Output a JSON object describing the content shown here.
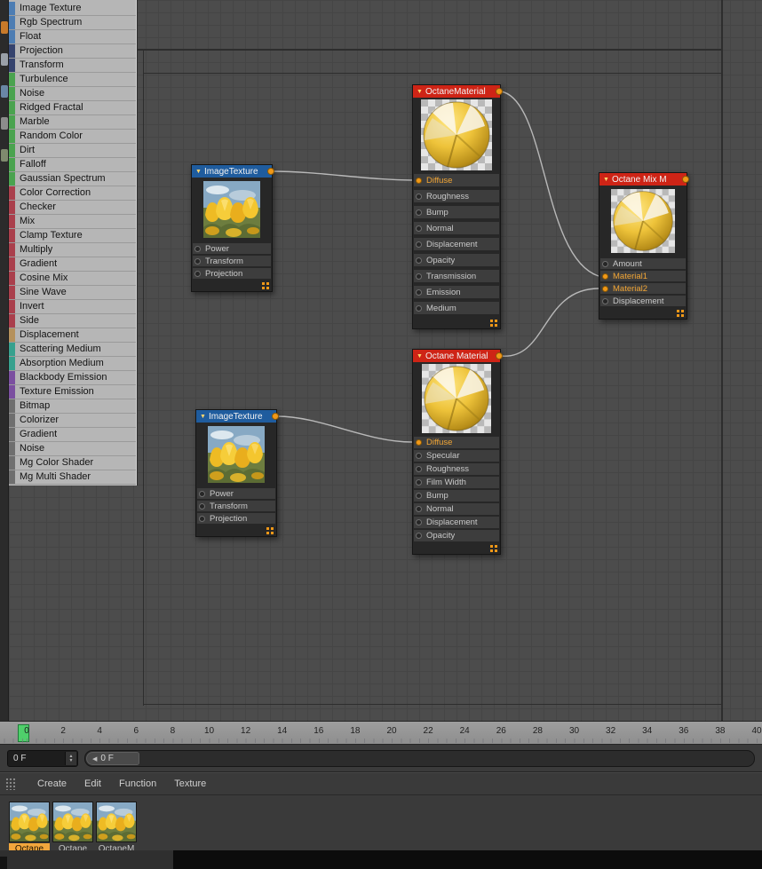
{
  "colors": {
    "accent_orange": "#f09818",
    "header_red": "#ce2416",
    "header_blue": "#1f5c9e",
    "selected_material_label": "#f2a63c",
    "playhead_green": "#4fcf6b"
  },
  "left_toolbar": {
    "icons": [
      "#c87a2a",
      "#9aa0a8",
      "#6a87a5",
      "#8c8c8c",
      "#7f8a6e"
    ]
  },
  "palette": {
    "items": [
      {
        "label": "Image Texture",
        "color": "#4d7db3"
      },
      {
        "label": "Rgb Spectrum",
        "color": "#4d7db3"
      },
      {
        "label": "Float",
        "color": "#4d7db3"
      },
      {
        "label": "Projection",
        "color": "#35436e"
      },
      {
        "label": "Transform",
        "color": "#35436e"
      },
      {
        "label": "Turbulence",
        "color": "#4aa34f"
      },
      {
        "label": "Noise",
        "color": "#4aa34f"
      },
      {
        "label": "Ridged Fractal",
        "color": "#4aa34f"
      },
      {
        "label": "Marble",
        "color": "#4aa34f"
      },
      {
        "label": "Random Color",
        "color": "#4aa34f"
      },
      {
        "label": "Dirt",
        "color": "#4aa34f"
      },
      {
        "label": "Falloff",
        "color": "#4aa34f"
      },
      {
        "label": "Gaussian Spectrum",
        "color": "#4aa34f"
      },
      {
        "label": "Color Correction",
        "color": "#aa3f4c"
      },
      {
        "label": "Checker",
        "color": "#aa3f4c"
      },
      {
        "label": "Mix",
        "color": "#aa3f4c"
      },
      {
        "label": "Clamp Texture",
        "color": "#aa3f4c"
      },
      {
        "label": "Multiply",
        "color": "#aa3f4c"
      },
      {
        "label": "Gradient",
        "color": "#aa3f4c"
      },
      {
        "label": "Cosine Mix",
        "color": "#aa3f4c"
      },
      {
        "label": "Sine Wave",
        "color": "#aa3f4c"
      },
      {
        "label": "Invert",
        "color": "#aa3f4c"
      },
      {
        "label": "Side",
        "color": "#aa3f4c"
      },
      {
        "label": "Displacement",
        "color": "#b5915c"
      },
      {
        "label": "Scattering Medium",
        "color": "#37a18e"
      },
      {
        "label": "Absorption Medium",
        "color": "#37a18e"
      },
      {
        "label": "Blackbody Emission",
        "color": "#7b4fa0"
      },
      {
        "label": "Texture Emission",
        "color": "#7b4fa0"
      },
      {
        "label": "Bitmap",
        "color": "#6f6f6f"
      },
      {
        "label": "Colorizer",
        "color": "#6f6f6f"
      },
      {
        "label": "Gradient",
        "color": "#6f6f6f"
      },
      {
        "label": "Noise",
        "color": "#6f6f6f"
      },
      {
        "label": "Mg Color Shader",
        "color": "#6f6f6f"
      },
      {
        "label": "Mg Multi Shader",
        "color": "#6f6f6f"
      }
    ]
  },
  "nodes": [
    {
      "title": "ImageTexture",
      "ports": [
        {
          "label": "Power"
        },
        {
          "label": "Transform"
        },
        {
          "label": "Projection"
        }
      ]
    },
    {
      "title": "OctaneMaterial",
      "ports": [
        {
          "label": "Diffuse",
          "connected": true
        },
        {
          "label": "Roughness"
        },
        {
          "label": "Bump"
        },
        {
          "label": "Normal"
        },
        {
          "label": "Displacement"
        },
        {
          "label": "Opacity"
        },
        {
          "label": "Transmission"
        },
        {
          "label": "Emission"
        },
        {
          "label": "Medium"
        }
      ]
    },
    {
      "title": "Octane Mix M",
      "ports": [
        {
          "label": "Amount"
        },
        {
          "label": "Material1",
          "connected": true
        },
        {
          "label": "Material2",
          "connected": true
        },
        {
          "label": "Displacement"
        }
      ]
    },
    {
      "title": "ImageTexture",
      "ports": [
        {
          "label": "Power"
        },
        {
          "label": "Transform"
        },
        {
          "label": "Projection"
        }
      ]
    },
    {
      "title": "Octane Material",
      "ports": [
        {
          "label": "Diffuse",
          "connected": true
        },
        {
          "label": "Specular"
        },
        {
          "label": "Roughness"
        },
        {
          "label": "Film Width"
        },
        {
          "label": "Bump"
        },
        {
          "label": "Normal"
        },
        {
          "label": "Displacement"
        },
        {
          "label": "Opacity"
        }
      ]
    }
  ],
  "timeline": {
    "ticks": [
      "0",
      "2",
      "4",
      "6",
      "8",
      "10",
      "12",
      "14",
      "16",
      "18",
      "20",
      "22",
      "24",
      "26",
      "28",
      "30",
      "32",
      "34",
      "36",
      "38",
      "40"
    ],
    "playhead_frame": "0"
  },
  "transport": {
    "frame_field": "0 F",
    "range_label": "0 F"
  },
  "materials": {
    "menu": [
      "Create",
      "Edit",
      "Function",
      "Texture"
    ],
    "items": [
      {
        "label": "Octane",
        "selected": true
      },
      {
        "label": "Octane"
      },
      {
        "label": "OctaneM"
      }
    ]
  }
}
